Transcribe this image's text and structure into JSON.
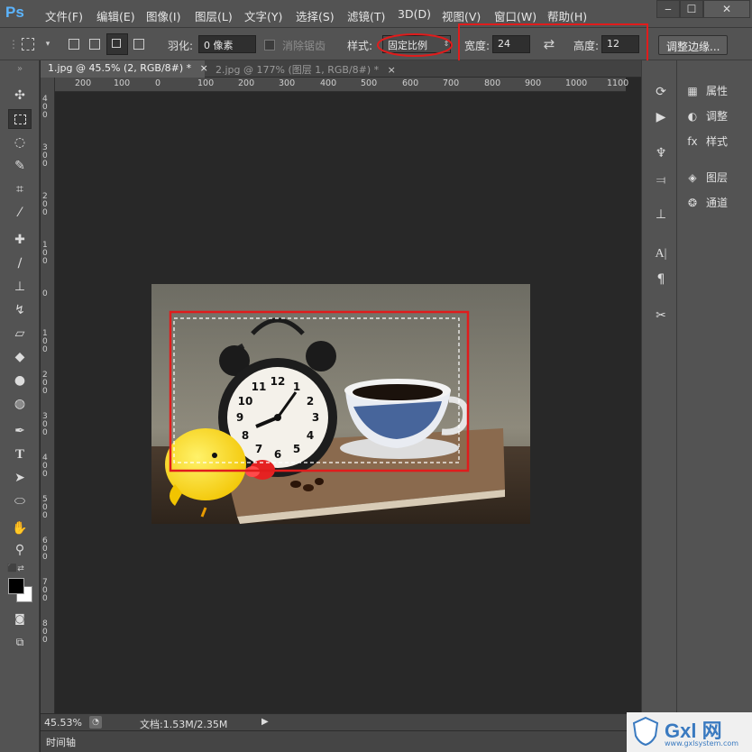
{
  "app": {
    "logo": "Ps"
  },
  "menu": [
    "文件(F)",
    "编辑(E)",
    "图像(I)",
    "图层(L)",
    "文字(Y)",
    "选择(S)",
    "滤镜(T)",
    "3D(D)",
    "视图(V)",
    "窗口(W)",
    "帮助(H)"
  ],
  "window_controls": {
    "minimize": "‒",
    "maximize": "☐",
    "close": "✕"
  },
  "options": {
    "feather_label": "羽化:",
    "feather_value": "0 像素",
    "antialias_label": "消除锯齿",
    "style_label": "样式:",
    "style_value": "固定比例",
    "width_label": "宽度:",
    "width_value": "24",
    "height_label": "高度:",
    "height_value": "12",
    "refine_edge_button": "调整边缘..."
  },
  "tabs": [
    {
      "label": "1.jpg @ 45.5% (2, RGB/8#) *"
    },
    {
      "label": "2.jpg @ 177% (图层 1, RGB/8#) *"
    }
  ],
  "ruler": {
    "h_ticks": [
      "200",
      "100",
      "0",
      "100",
      "200",
      "300",
      "400",
      "500",
      "600",
      "700",
      "800",
      "900",
      "1000",
      "1100"
    ],
    "v_ticks": [
      "400",
      "300",
      "200",
      "100",
      "0",
      "100",
      "200",
      "300",
      "400",
      "500",
      "600",
      "700",
      "800"
    ]
  },
  "right_panel": {
    "items": [
      "属性",
      "调整",
      "样式",
      "图层",
      "通道"
    ]
  },
  "status": {
    "zoom": "45.53%",
    "doc_size": "文档:1.53M/2.35M",
    "timeline_tab": "时间轴"
  },
  "clock_numbers": [
    "12",
    "1",
    "2",
    "3",
    "4",
    "5",
    "6",
    "7",
    "8",
    "9",
    "10",
    "11"
  ],
  "watermark": {
    "brand": "Gxl 网",
    "url": "www.gxlsystem.com"
  },
  "colors": {
    "highlight_red": "#e01c1c",
    "panel_bg": "#535353",
    "canvas_bg": "#282828",
    "ps_blue": "#5bb4ff"
  }
}
